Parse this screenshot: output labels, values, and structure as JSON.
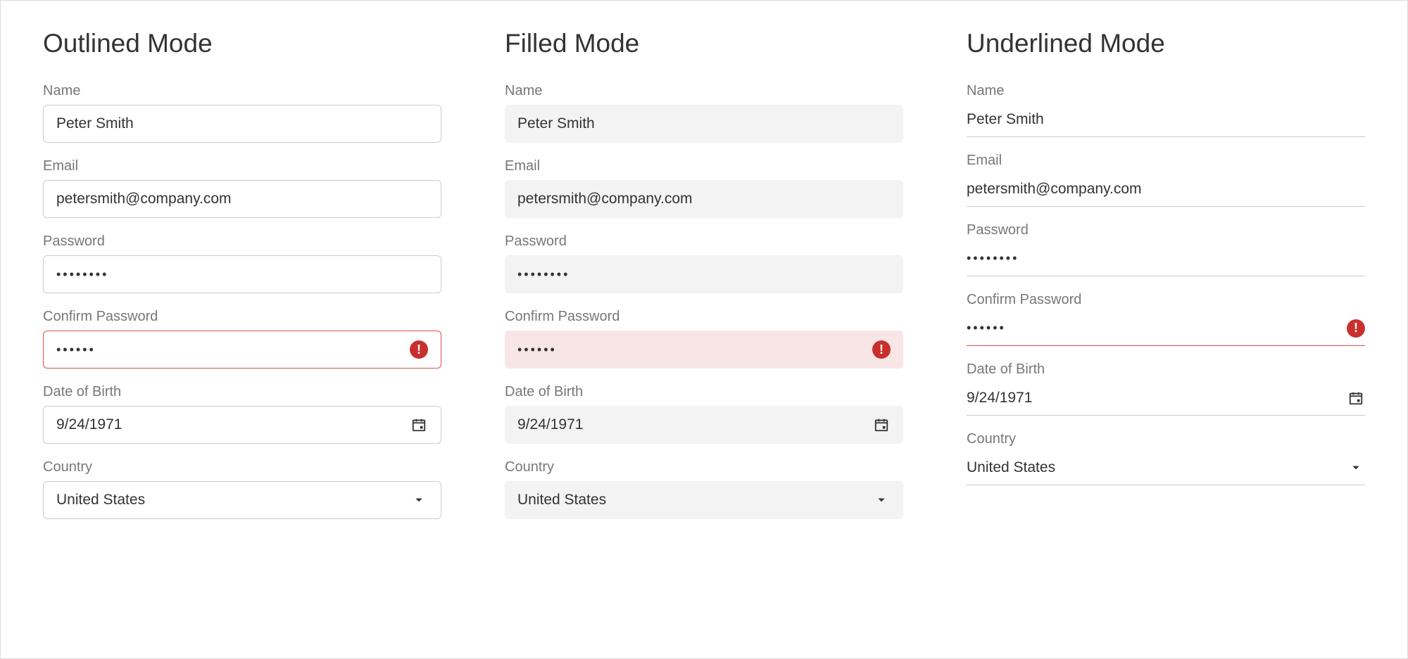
{
  "sections": {
    "outlined": {
      "title": "Outlined Mode"
    },
    "filled": {
      "title": "Filled Mode"
    },
    "underlined": {
      "title": "Underlined Mode"
    }
  },
  "labels": {
    "name": "Name",
    "email": "Email",
    "password": "Password",
    "confirm_password": "Confirm Password",
    "dob": "Date of Birth",
    "country": "Country"
  },
  "values": {
    "name": "Peter Smith",
    "email": "petersmith@company.com",
    "password": "••••••••",
    "confirm_password": "••••••",
    "dob": "9/24/1971",
    "country": "United States"
  },
  "icons": {
    "error": "!",
    "dropdown": "▼"
  },
  "colors": {
    "error": "#c9302c",
    "filled_bg": "#f3f3f3",
    "filled_invalid_bg": "#f8e6e6",
    "label": "#777777"
  }
}
